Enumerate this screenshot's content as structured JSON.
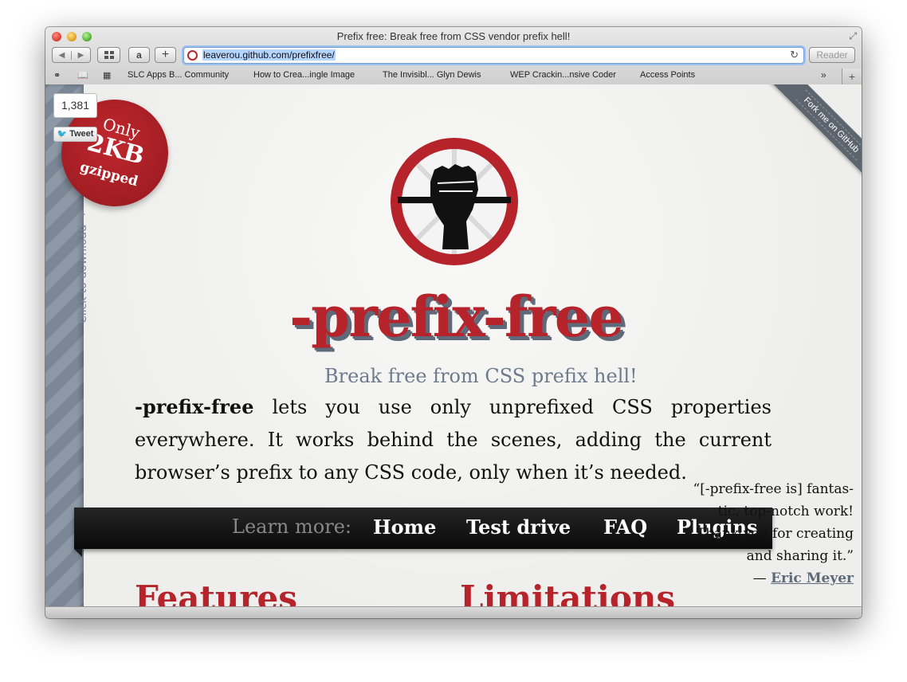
{
  "window": {
    "title": "Prefix free: Break free from CSS vendor prefix hell!"
  },
  "toolbar": {
    "back_icon": "back-arrow-icon",
    "forward_icon": "forward-arrow-icon",
    "amazon_label": "a",
    "add_label": "+",
    "url": "leaverou.github.com/prefixfree/",
    "reader_label": "Reader"
  },
  "bookmarks": {
    "items": [
      "SLC Apps B... Community",
      "How to Crea...ingle Image",
      "The Invisibl... Glyn Dewis",
      "WEP Crackin...nsive Coder",
      "Access Points"
    ],
    "more": "»",
    "new_tab": "+"
  },
  "page": {
    "tweet_count": "1,381",
    "tweet_label": "Tweet",
    "badge": {
      "line1": "Only",
      "line2": "2KB",
      "line3": "gzipped"
    },
    "download_label": "Click to download →",
    "github_ribbon": "Fork me on GitHub",
    "title": "-prefix-free",
    "tagline": "Break free from CSS prefix hell!",
    "intro_bold": "-prefix-free",
    "intro_rest": " lets you use only unprefixed CSS properties everywhere. It works behind the scenes, adding the current browser’s prefix to any CSS code, only when it’s needed.",
    "nav": {
      "label": "Learn more:",
      "links": [
        "Home",
        "Test drive",
        "FAQ",
        "Plugins"
      ]
    },
    "quote": {
      "text": "“[-prefix-free is] fantas-tic, top-notch work! Thank you for creating and sharing it.”",
      "dash": "— ",
      "author": "Eric Meyer"
    },
    "headings": [
      "Features",
      "Limitations"
    ]
  },
  "colors": {
    "brand_red": "#b6232a",
    "slate": "#5e6a79",
    "navbar": "#111111"
  }
}
